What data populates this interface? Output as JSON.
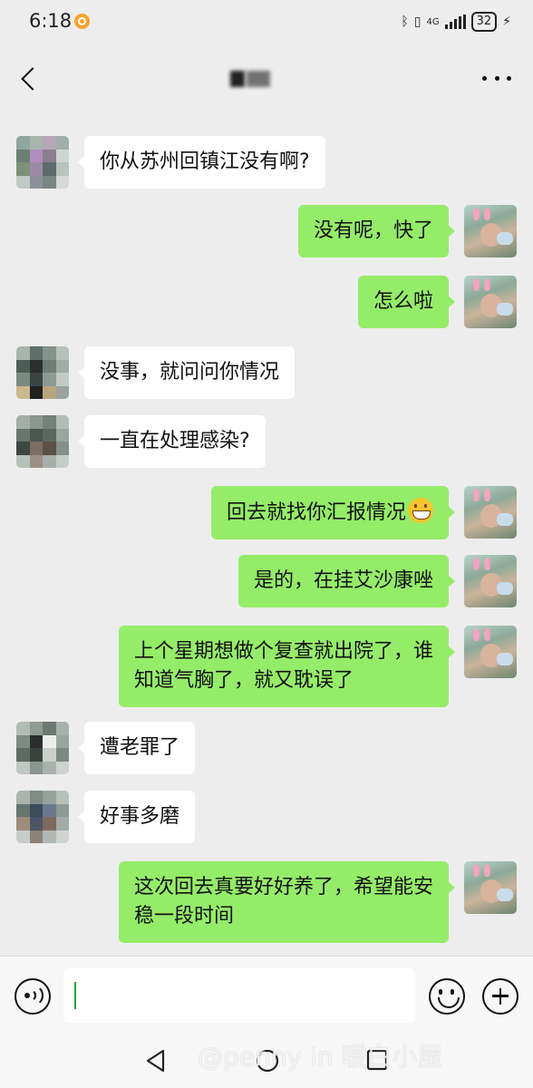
{
  "status_bar": {
    "time": "6:18",
    "network": "4G",
    "battery": "32"
  },
  "header": {
    "title": "",
    "back_icon": "chevron-left-icon",
    "more_icon": "more-dots-icon"
  },
  "messages": [
    {
      "side": "left",
      "text": "你从苏州回镇江没有啊?"
    },
    {
      "side": "right",
      "text": "没有呢，快了"
    },
    {
      "side": "right",
      "text": "怎么啦"
    },
    {
      "side": "left",
      "text": "没事，就问问你情况"
    },
    {
      "side": "left",
      "text": "一直在处理感染?"
    },
    {
      "side": "right",
      "text": "回去就找你汇报情况",
      "emoji": "grin-emoji"
    },
    {
      "side": "right",
      "text": "是的，在挂艾沙康唑"
    },
    {
      "side": "right",
      "lines": [
        "上个星期想做个复查就出院了，谁",
        "知道气胸了，就又耽误了"
      ]
    },
    {
      "side": "left",
      "text": "遭老罪了"
    },
    {
      "side": "left",
      "text": "好事多磨"
    },
    {
      "side": "right",
      "lines": [
        "这次回去真要好好养了，希望能安",
        "稳一段时间"
      ]
    }
  ],
  "input_bar": {
    "value": "",
    "voice_icon": "voice-icon",
    "emoji_icon": "emoji-icon",
    "plus_icon": "plus-icon"
  },
  "watermark": "@penny in 暖白小屋",
  "colors": {
    "background": "#ededed",
    "sent_bubble": "#95ec69",
    "received_bubble": "#ffffff",
    "input_bar": "#f7f7f7"
  }
}
